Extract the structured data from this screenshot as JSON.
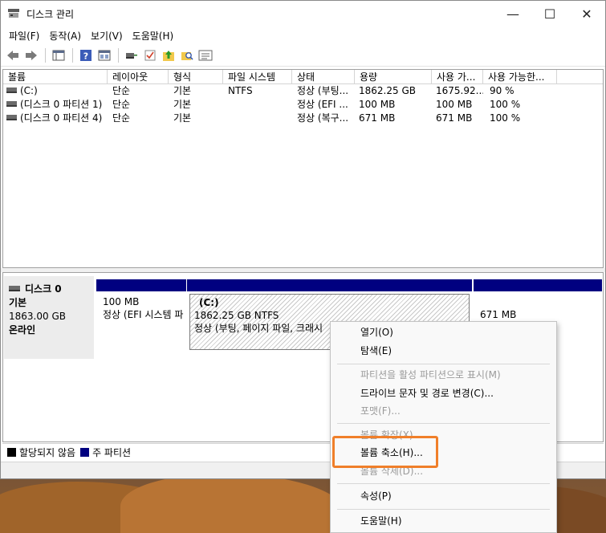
{
  "window": {
    "title": "디스크 관리"
  },
  "menu": [
    "파일(F)",
    "동작(A)",
    "보기(V)",
    "도움말(H)"
  ],
  "toolbar": [
    {
      "name": "back-arrow-icon",
      "glyph": "⇦"
    },
    {
      "name": "forward-arrow-icon",
      "glyph": "⇨"
    },
    {
      "name": "console-tree-icon",
      "glyph": "▤"
    },
    {
      "name": "help-icon",
      "glyph": "?"
    },
    {
      "name": "properties-icon",
      "glyph": "▣"
    },
    {
      "name": "connect-disk-icon",
      "glyph": "⊟"
    },
    {
      "name": "check-disk-icon",
      "glyph": "☑"
    },
    {
      "name": "up-folder-icon",
      "glyph": "⬆"
    },
    {
      "name": "search-folder-icon",
      "glyph": "⌕"
    },
    {
      "name": "settings-list-icon",
      "glyph": "☰"
    }
  ],
  "columns": [
    "볼륨",
    "레이아웃",
    "형식",
    "파일 시스템",
    "상태",
    "용량",
    "사용 가...",
    "사용 가능한..."
  ],
  "rows": [
    [
      "(C:)",
      "단순",
      "기본",
      "NTFS",
      "정상 (부팅...",
      "1862.25 GB",
      "1675.92...",
      "90 %"
    ],
    [
      "(디스크 0 파티션 1)",
      "단순",
      "기본",
      "",
      "정상 (EFI ...",
      "100 MB",
      "100 MB",
      "100 %"
    ],
    [
      "(디스크 0 파티션 4)",
      "단순",
      "기본",
      "",
      "정상 (복구...",
      "671 MB",
      "671 MB",
      "100 %"
    ]
  ],
  "disk": {
    "name": "디스크 0",
    "type": "기본",
    "size": "1863.00 GB",
    "status": "온라인",
    "partitions": [
      {
        "label": "",
        "size": "100 MB",
        "status": "정상 (EFI 시스템 파"
      },
      {
        "label": "(C:)",
        "size": "1862.25 GB NTFS",
        "status": "정상 (부팅, 페이지 파일, 크래시"
      },
      {
        "label": "",
        "size": "671 MB",
        "status": ""
      }
    ]
  },
  "legend": {
    "unallocated": "할당되지 않음",
    "primary": "주 파티션"
  },
  "context_menu": [
    {
      "label": "열기(O)",
      "enabled": true
    },
    {
      "label": "탐색(E)",
      "enabled": true
    },
    {
      "label": "파티션을 활성 파티션으로 표시(M)",
      "enabled": false
    },
    {
      "label": "드라이브 문자 및 경로 변경(C)...",
      "enabled": true
    },
    {
      "label": "포맷(F)...",
      "enabled": false
    },
    {
      "label": "볼륨 확장(X)...",
      "enabled": false
    },
    {
      "label": "볼륨 축소(H)...",
      "enabled": true
    },
    {
      "label": "볼륨 삭제(D)...",
      "enabled": false
    },
    {
      "label": "속성(P)",
      "enabled": true
    },
    {
      "label": "도움말(H)",
      "enabled": true
    }
  ],
  "colors": {
    "primary_partition": "#000080",
    "highlight": "#f07f2a",
    "unallocated": "#000000"
  }
}
